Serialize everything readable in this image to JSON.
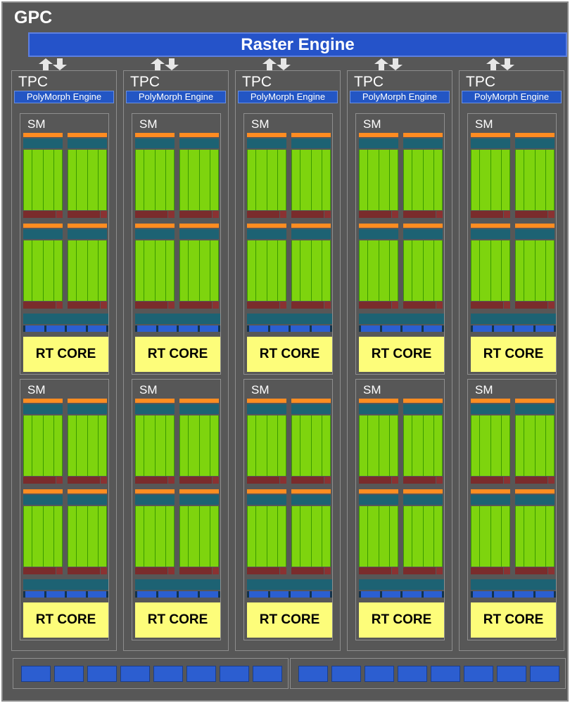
{
  "gpc": {
    "title": "GPC",
    "raster_engine": "Raster Engine",
    "tpcs": [
      {
        "title": "TPC",
        "polymorph": "PolyMorph Engine",
        "sms": [
          {
            "title": "SM",
            "rt_core": "RT CORE"
          },
          {
            "title": "SM",
            "rt_core": "RT CORE"
          }
        ]
      },
      {
        "title": "TPC",
        "polymorph": "PolyMorph Engine",
        "sms": [
          {
            "title": "SM",
            "rt_core": "RT CORE"
          },
          {
            "title": "SM",
            "rt_core": "RT CORE"
          }
        ]
      },
      {
        "title": "TPC",
        "polymorph": "PolyMorph Engine",
        "sms": [
          {
            "title": "SM",
            "rt_core": "RT CORE"
          },
          {
            "title": "SM",
            "rt_core": "RT CORE"
          }
        ]
      },
      {
        "title": "TPC",
        "polymorph": "PolyMorph Engine",
        "sms": [
          {
            "title": "SM",
            "rt_core": "RT CORE"
          },
          {
            "title": "SM",
            "rt_core": "RT CORE"
          }
        ]
      },
      {
        "title": "TPC",
        "polymorph": "PolyMorph Engine",
        "sms": [
          {
            "title": "SM",
            "rt_core": "RT CORE"
          },
          {
            "title": "SM",
            "rt_core": "RT CORE"
          }
        ]
      }
    ],
    "bottom_units": {
      "groups": 2,
      "blocks_per_group": 8
    }
  },
  "colors": {
    "background": "#575757",
    "raster_engine": "#2553c9",
    "polymorph": "#2356c4",
    "cuda_core": "#7ed40e",
    "register_file": "#1d6273",
    "dispatch": "#ff8c21",
    "load_store": "#7a2c2c",
    "rt_core": "#fdfd7a",
    "unit_block": "#2c5ed0"
  }
}
